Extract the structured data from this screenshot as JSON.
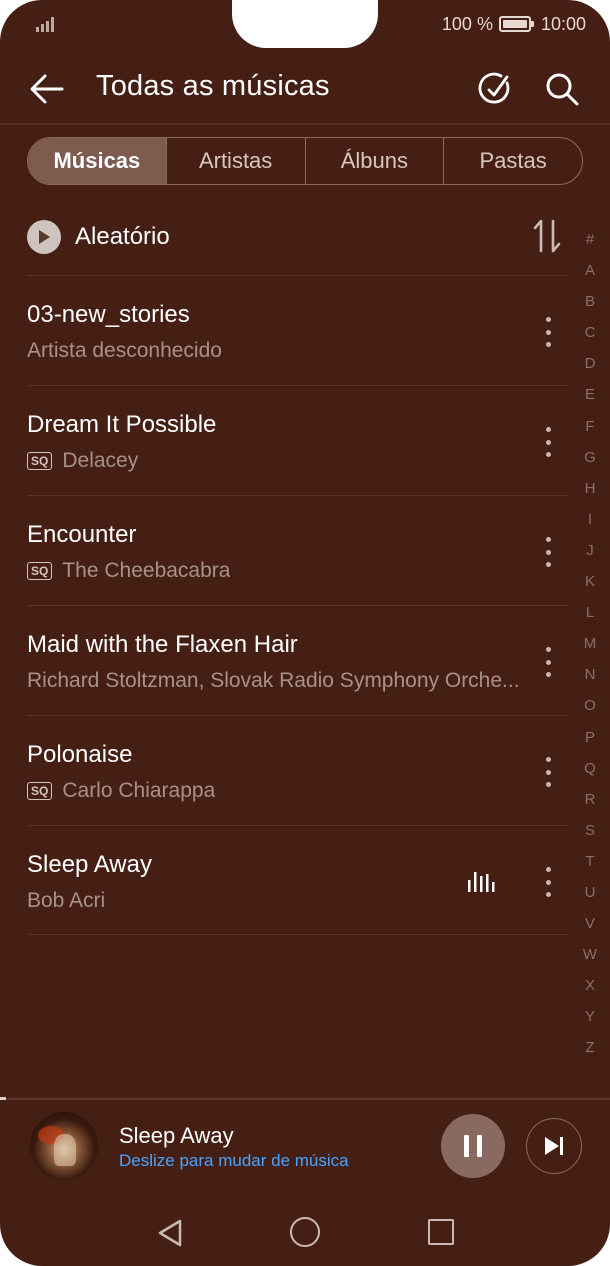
{
  "status_bar": {
    "battery": "100 %",
    "time": "10:00"
  },
  "header": {
    "title": "Todas as músicas"
  },
  "tabs": [
    {
      "label": "Músicas",
      "active": true
    },
    {
      "label": "Artistas",
      "active": false
    },
    {
      "label": "Álbuns",
      "active": false
    },
    {
      "label": "Pastas",
      "active": false
    }
  ],
  "shuffle": {
    "label": "Aleatório"
  },
  "songs": [
    {
      "title": "03-new_stories",
      "artist": "Artista desconhecido",
      "sq": false,
      "playing": false
    },
    {
      "title": "Dream It Possible",
      "artist": "Delacey",
      "sq": true,
      "playing": false
    },
    {
      "title": "Encounter",
      "artist": "The Cheebacabra",
      "sq": true,
      "playing": false
    },
    {
      "title": "Maid with the Flaxen Hair",
      "artist": "Richard Stoltzman, Slovak Radio Symphony Orche...",
      "sq": false,
      "playing": false
    },
    {
      "title": "Polonaise",
      "artist": "Carlo Chiarappa",
      "sq": true,
      "playing": false
    },
    {
      "title": "Sleep Away",
      "artist": "Bob Acri",
      "sq": false,
      "playing": true
    }
  ],
  "sq_badge_label": "SQ",
  "index_letters": [
    "#",
    "A",
    "B",
    "C",
    "D",
    "E",
    "F",
    "G",
    "H",
    "I",
    "J",
    "K",
    "L",
    "M",
    "N",
    "O",
    "P",
    "Q",
    "R",
    "S",
    "T",
    "U",
    "V",
    "W",
    "X",
    "Y",
    "Z"
  ],
  "player": {
    "title": "Sleep Away",
    "hint": "Deslize para mudar de música"
  },
  "colors": {
    "background": "#451f14",
    "accent_hint": "#4aa3ff"
  }
}
